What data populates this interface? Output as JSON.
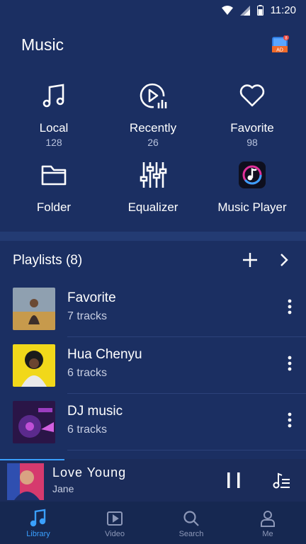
{
  "status_bar": {
    "time": "11:20"
  },
  "header": {
    "title": "Music",
    "ad_badge_text": "AD",
    "ad_badge_count": "8"
  },
  "quick_access": [
    {
      "label": "Local",
      "count": "128",
      "icon": "music-note-icon"
    },
    {
      "label": "Recently",
      "count": "26",
      "icon": "recent-play-icon"
    },
    {
      "label": "Favorite",
      "count": "98",
      "icon": "heart-icon"
    },
    {
      "label": "Folder",
      "icon": "folder-icon"
    },
    {
      "label": "Equalizer",
      "icon": "equalizer-icon"
    },
    {
      "label": "Music Player",
      "icon": "music-player-app-icon"
    }
  ],
  "playlists": {
    "title": "Playlists (8)",
    "items": [
      {
        "name": "Favorite",
        "tracks": "7 tracks"
      },
      {
        "name": "Hua Chenyu",
        "tracks": "6 tracks"
      },
      {
        "name": "DJ music",
        "tracks": "6 tracks"
      }
    ]
  },
  "now_playing": {
    "song": "Love Young",
    "artist": "Jane",
    "progress": 0.21
  },
  "tabs": [
    {
      "label": "Library",
      "active": true
    },
    {
      "label": "Video",
      "active": false
    },
    {
      "label": "Search",
      "active": false
    },
    {
      "label": "Me",
      "active": false
    }
  ],
  "colors": {
    "background": "#1b2f62",
    "accent": "#3aa0ff",
    "tab_inactive": "#8d98b8"
  }
}
